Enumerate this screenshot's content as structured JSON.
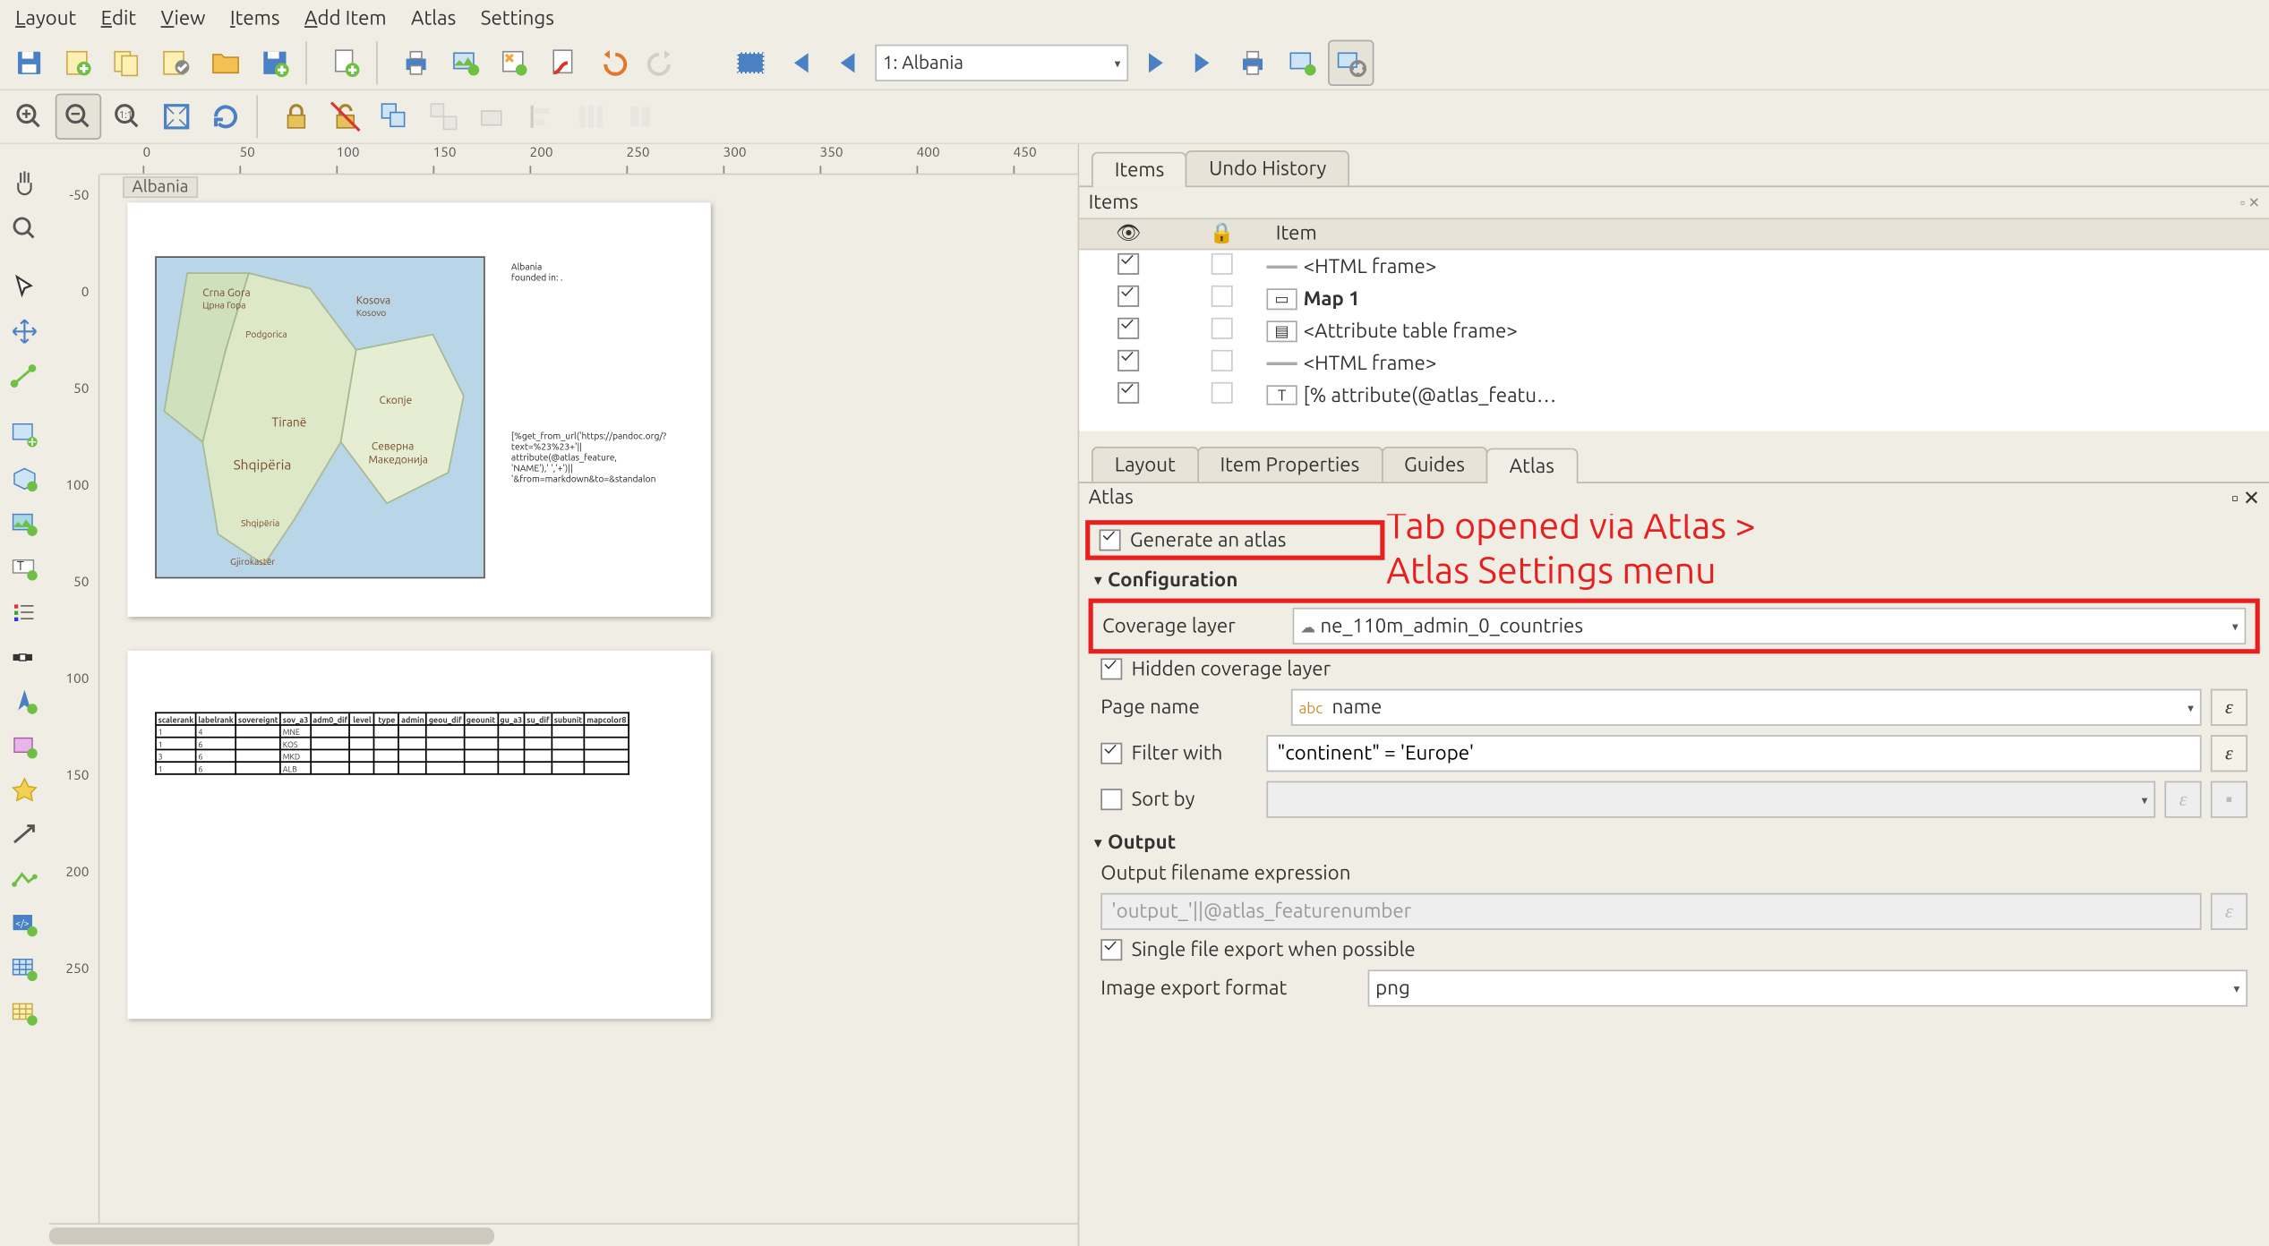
{
  "menu": [
    "Layout",
    "Edit",
    "View",
    "Items",
    "Add Item",
    "Atlas",
    "Settings"
  ],
  "menu_u": [
    "L",
    "E",
    "V",
    "I",
    "A",
    "",
    ""
  ],
  "atlas_nav_value": "1: Albania",
  "ruler_h": [
    0,
    50,
    100,
    150,
    200,
    250,
    300,
    350,
    400,
    450
  ],
  "ruler_v": [
    -50,
    0,
    50,
    100,
    50,
    100,
    150,
    200,
    250
  ],
  "page1_label": "Albania",
  "page1_text1": "Albania\nfounded in: .",
  "page1_text2": "[%get_from_url('https://pandoc.org/?text=%23%23+'||\nattribute(@atlas_feature,\n'NAME'),' ','+')||\n'&from=markdown&to=&standalon",
  "attr_headers": [
    "scalerank",
    "labelrank",
    "sovereignt",
    "sov_a3",
    "adm0_dif",
    "level",
    "type",
    "admin",
    "geou_dif",
    "geounit",
    "gu_a3",
    "su_dif",
    "subunit",
    "mapcolor8"
  ],
  "attr_rows": [
    [
      "1",
      "4",
      "",
      "MNE",
      "",
      "",
      "",
      "",
      "",
      "",
      "",
      "",
      "",
      ""
    ],
    [
      "1",
      "6",
      "",
      "KOS",
      "",
      "",
      "",
      "",
      "",
      "",
      "",
      "",
      "",
      ""
    ],
    [
      "3",
      "6",
      "",
      "MKD",
      "",
      "",
      "",
      "",
      "",
      "",
      "",
      "",
      "",
      ""
    ],
    [
      "1",
      "6",
      "",
      "ALB",
      "",
      "",
      "",
      "",
      "",
      "",
      "",
      "",
      "",
      ""
    ]
  ],
  "items_panel": {
    "tab1": "Items",
    "tab2": "Undo History",
    "title": "Items",
    "hdr_eye": "👁",
    "hdr_lock": "🔒",
    "hdr_item": "Item",
    "rows": [
      {
        "on": true,
        "icon": "</>",
        "label": "<HTML frame>"
      },
      {
        "on": true,
        "icon": "▭",
        "label": "Map 1",
        "bold": true
      },
      {
        "on": true,
        "icon": "▤",
        "label": "<Attribute table frame>"
      },
      {
        "on": true,
        "icon": "</>",
        "label": "<HTML frame>"
      },
      {
        "on": true,
        "icon": "T",
        "label": "[% attribute(@atlas_featu…"
      }
    ]
  },
  "prop_tabs": [
    "Layout",
    "Item Properties",
    "Guides",
    "Atlas"
  ],
  "atlas_panel": {
    "title": "Atlas",
    "generate": "Generate an atlas",
    "cfg": "Configuration",
    "cov_label": "Coverage layer",
    "cov_value": "ne_110m_admin_0_countries",
    "hidden": "Hidden coverage layer",
    "page_label": "Page name",
    "page_value": "name",
    "page_prefix": "abc",
    "filter_label": "Filter with",
    "filter_value": "\"continent\" = 'Europe'",
    "sort_label": "Sort by",
    "out": "Output",
    "out_expr_label": "Output filename expression",
    "out_expr_value": "'output_'||@atlas_featurenumber",
    "single": "Single file export when possible",
    "imgfmt_label": "Image export format",
    "imgfmt_value": "png"
  },
  "red_annot": "Tab opened via Atlas > Atlas Settings menu"
}
